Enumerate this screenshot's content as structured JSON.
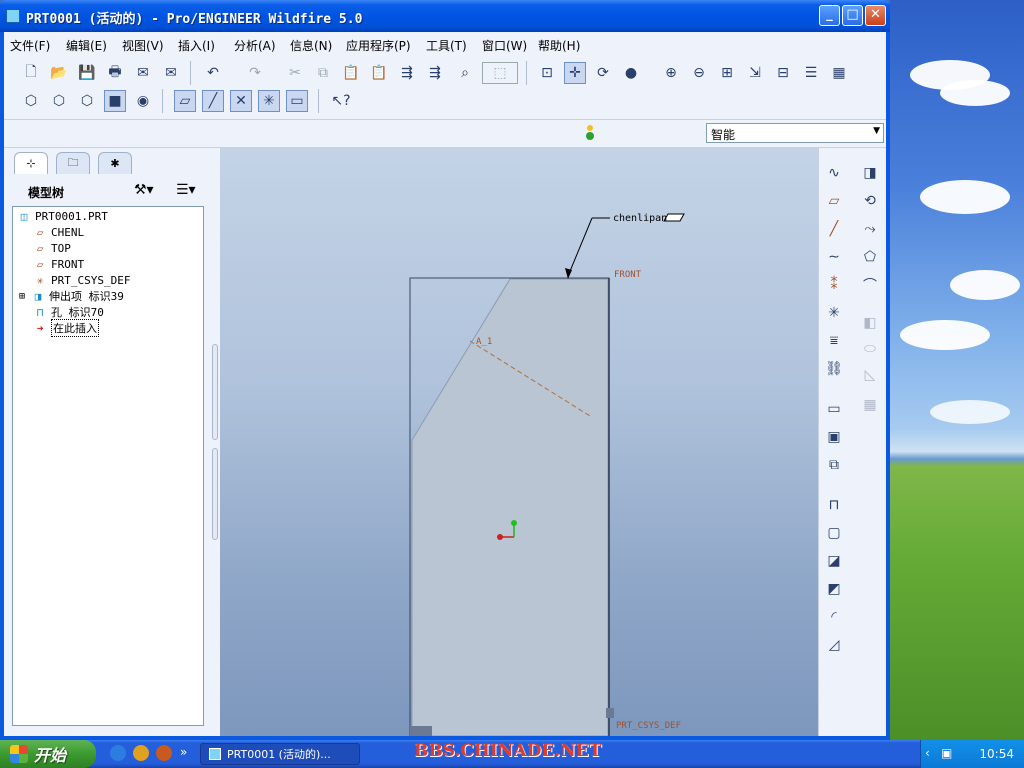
{
  "window": {
    "title": "PRT0001 (活动的) - Pro/ENGINEER Wildfire 5.0",
    "minimize": "_",
    "maximize": "□",
    "close": "✕"
  },
  "menu": {
    "items": [
      "文件(F)",
      "编辑(E)",
      "视图(V)",
      "插入(I)",
      "分析(A)",
      "信息(N)",
      "应用程序(P)",
      "工具(T)",
      "窗口(W)",
      "帮助(H)"
    ]
  },
  "smart_filter": {
    "value": "智能"
  },
  "model_tree": {
    "title": "模型树",
    "items": [
      {
        "label": "PRT0001.PRT",
        "icon": "part-icon"
      },
      {
        "label": "CHENL",
        "icon": "datum-plane-icon"
      },
      {
        "label": "TOP",
        "icon": "datum-plane-icon"
      },
      {
        "label": "FRONT",
        "icon": "datum-plane-icon"
      },
      {
        "label": "PRT_CSYS_DEF",
        "icon": "csys-icon"
      },
      {
        "label": "伸出项 标识39",
        "icon": "extrude-icon"
      },
      {
        "label": "孔 标识70",
        "icon": "hole-icon"
      },
      {
        "label": "在此插入",
        "icon": "insert-arrow-icon"
      }
    ]
  },
  "graphics": {
    "annotations": {
      "chenl": "chenlipan",
      "front": "FRONT",
      "axis": "A_1",
      "csys": "PRT_CSYS_DEF"
    }
  },
  "taskbar": {
    "start_label": "开始",
    "task_item": "PRT0001 (活动的)...",
    "watermark": "BBS.CHINADE.NET",
    "clock": "10:54"
  }
}
